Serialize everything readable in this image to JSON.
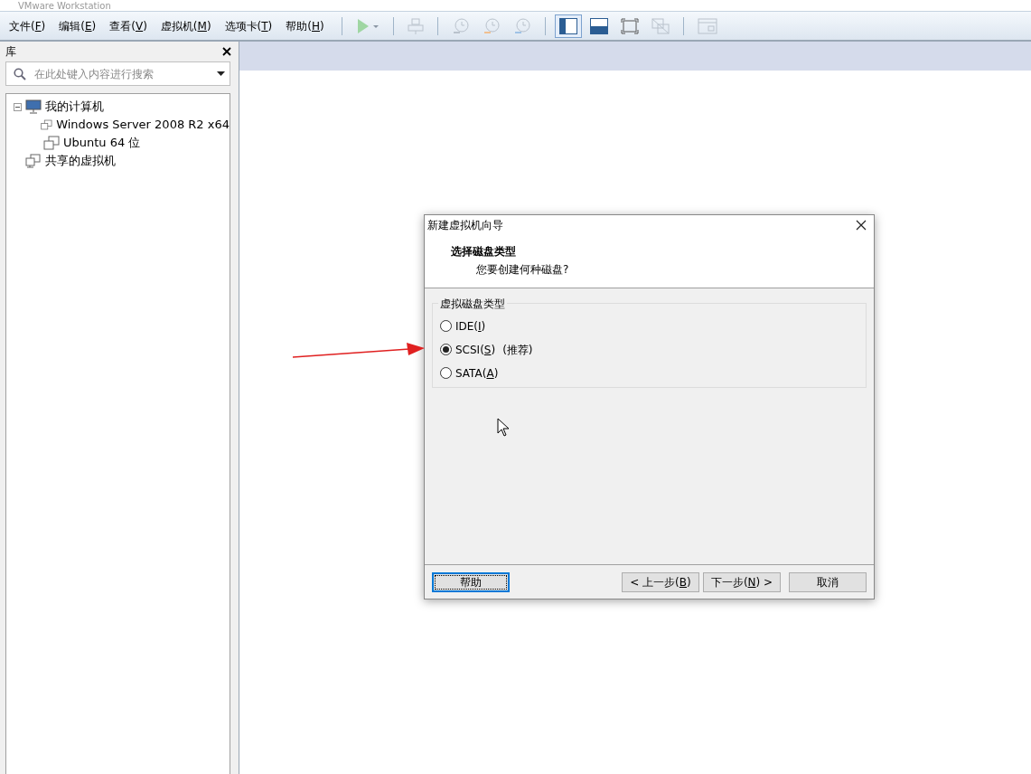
{
  "window": {
    "title": "VMware Workstation"
  },
  "menu": [
    {
      "text": "文件(",
      "key": "F",
      "after": ")"
    },
    {
      "text": "编辑(",
      "key": "E",
      "after": ")"
    },
    {
      "text": "查看(",
      "key": "V",
      "after": ")"
    },
    {
      "text": "虚拟机(",
      "key": "M",
      "after": ")"
    },
    {
      "text": "选项卡(",
      "key": "T",
      "after": ")"
    },
    {
      "text": "帮助(",
      "key": "H",
      "after": ")"
    }
  ],
  "toolbar": [
    {
      "kind": "play",
      "disabled": true,
      "selected": false
    },
    {
      "kind": "sep"
    },
    {
      "kind": "send-keys",
      "disabled": true,
      "selected": false
    },
    {
      "kind": "sep"
    },
    {
      "kind": "snapshot",
      "disabled": true,
      "selected": false
    },
    {
      "kind": "revert",
      "disabled": true,
      "selected": false
    },
    {
      "kind": "manage",
      "disabled": true,
      "selected": false
    },
    {
      "kind": "sep"
    },
    {
      "kind": "library",
      "disabled": false,
      "selected": true
    },
    {
      "kind": "thumbnail",
      "disabled": false,
      "selected": false
    },
    {
      "kind": "fullscreen",
      "disabled": false,
      "selected": false
    },
    {
      "kind": "unity",
      "disabled": true,
      "selected": false
    },
    {
      "kind": "sep"
    },
    {
      "kind": "console",
      "disabled": true,
      "selected": false
    }
  ],
  "library": {
    "title": "库",
    "search": {
      "placeholder": "在此处键入内容进行搜索"
    },
    "tree": [
      {
        "label": "我的计算机",
        "kind": "computer",
        "expanded": true,
        "children": [
          {
            "label": "Windows Server 2008 R2 x64",
            "kind": "vm"
          },
          {
            "label": "Ubuntu 64 位",
            "kind": "vm"
          }
        ]
      },
      {
        "label": "共享的虚拟机",
        "kind": "shared"
      }
    ]
  },
  "dialog": {
    "title": "新建虚拟机向导",
    "heading": "选择磁盘类型",
    "subheading": "您要创建何种磁盘?",
    "group": "虚拟磁盘类型",
    "options": [
      {
        "text": "IDE(",
        "key": "I",
        "after": ")",
        "selected": false
      },
      {
        "text": "SCSI(",
        "key": "S",
        "after": ")",
        "note": "(推荐)",
        "selected": true
      },
      {
        "text": "SATA(",
        "key": "A",
        "after": ")",
        "selected": false
      }
    ],
    "buttons": [
      {
        "text": "帮助",
        "focused": true
      },
      {
        "text": "< 上一步(",
        "key": "B",
        "after": ")",
        "focused": false
      },
      {
        "text": "下一步(",
        "key": "N",
        "after": ") >",
        "focused": false
      },
      {
        "text": "取消",
        "focused": false
      }
    ]
  }
}
